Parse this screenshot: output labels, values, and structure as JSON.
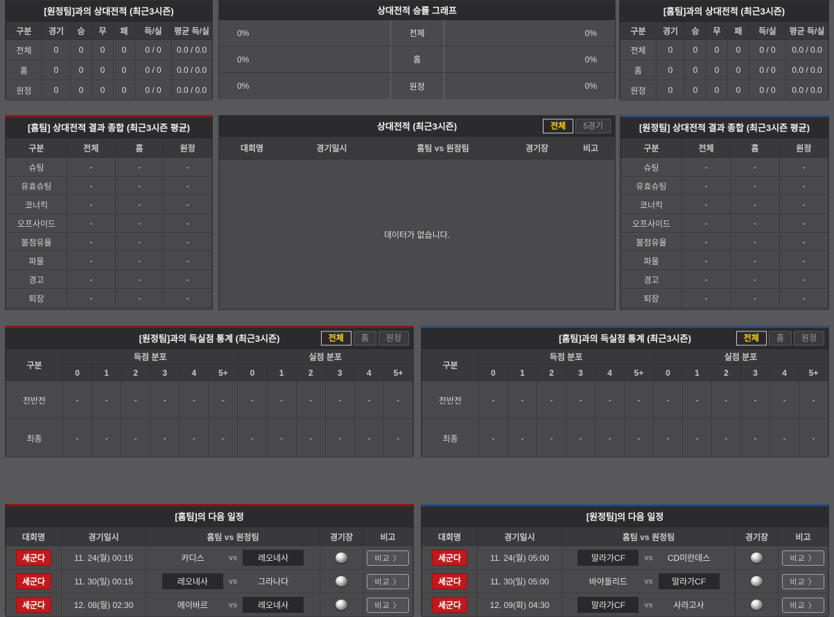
{
  "ui": {
    "vs_label": "vs",
    "compare_button": "비교 〉",
    "empty_dash": "-",
    "empty_message": "데이터가 없습니다."
  },
  "colors": {
    "accent_red": "#8e1418",
    "accent_blue": "#2a4d86",
    "badge_red": "#c2191c",
    "tab_active_text": "#ffd400",
    "page_bg": "#58585a",
    "panel_bg": "#4a4a4c"
  },
  "top_left_record": {
    "title": "[원정팀]과의 상대전적 (최근3시즌)",
    "headers": [
      "구분",
      "경기",
      "승",
      "무",
      "패",
      "득/실",
      "평균 득/실"
    ],
    "rows": [
      {
        "label": "전체",
        "values": [
          "0",
          "0",
          "0",
          "0",
          "0 / 0",
          "0.0 / 0.0"
        ]
      },
      {
        "label": "홈",
        "values": [
          "0",
          "0",
          "0",
          "0",
          "0 / 0",
          "0.0 / 0.0"
        ]
      },
      {
        "label": "원정",
        "values": [
          "0",
          "0",
          "0",
          "0",
          "0 / 0",
          "0.0 / 0.0"
        ]
      }
    ]
  },
  "winrate_graph": {
    "title": "상대전적 승률 그래프",
    "rows": [
      {
        "label": "전체",
        "left_value": "0%",
        "right_value": "0%"
      },
      {
        "label": "홈",
        "left_value": "0%",
        "right_value": "0%"
      },
      {
        "label": "원정",
        "left_value": "0%",
        "right_value": "0%"
      }
    ]
  },
  "top_right_record": {
    "title": "[홈팀]과의 상대전적 (최근3시즌)",
    "headers": [
      "구분",
      "경기",
      "승",
      "무",
      "패",
      "득/실",
      "평균 득/실"
    ],
    "rows": [
      {
        "label": "전체",
        "values": [
          "0",
          "0",
          "0",
          "0",
          "0 / 0",
          "0.0 / 0.0"
        ]
      },
      {
        "label": "홈",
        "values": [
          "0",
          "0",
          "0",
          "0",
          "0 / 0",
          "0.0 / 0.0"
        ]
      },
      {
        "label": "원정",
        "values": [
          "0",
          "0",
          "0",
          "0",
          "0 / 0",
          "0.0 / 0.0"
        ]
      }
    ]
  },
  "home_summary": {
    "title": "[홈팀] 상대전적 결과 종합 (최근3시즌 평균)",
    "headers": [
      "구분",
      "전체",
      "홈",
      "원정"
    ],
    "row_labels": [
      "슈팅",
      "유효슈팅",
      "코너킥",
      "오프사이드",
      "볼점유율",
      "파울",
      "경고",
      "퇴장"
    ]
  },
  "h2h": {
    "title": "상대전적 (최근3시즌)",
    "tabs": [
      {
        "label": "전체",
        "active": true
      },
      {
        "label": "5경기",
        "active": false
      }
    ],
    "headers": [
      "대회명",
      "경기일시",
      "홈팀  vs  원정팀",
      "경기장",
      "비고"
    ]
  },
  "away_summary": {
    "title": "[원정팀] 상대전적 결과 종합 (최근3시즌 평균)",
    "headers": [
      "구분",
      "전체",
      "홈",
      "원정"
    ],
    "row_labels": [
      "슈팅",
      "유효슈팅",
      "코너킥",
      "오프사이드",
      "볼점유율",
      "파울",
      "경고",
      "퇴장"
    ]
  },
  "goals_vs_away": {
    "title": "[원정팀]과의 득실점 통계 (최근3시즌)",
    "tabs": [
      {
        "label": "전체",
        "active": true
      },
      {
        "label": "홈",
        "active": false
      },
      {
        "label": "원정",
        "active": false
      }
    ],
    "corner_header": "구분",
    "group_headers": [
      "득점 분포",
      "실점 분포"
    ],
    "bins": [
      "0",
      "1",
      "2",
      "3",
      "4",
      "5+"
    ],
    "row_labels": [
      "전반전",
      "최종"
    ]
  },
  "goals_vs_home": {
    "title": "[홈팀]과의 득실점 통계 (최근3시즌)",
    "tabs": [
      {
        "label": "전체",
        "active": true
      },
      {
        "label": "홈",
        "active": false
      },
      {
        "label": "원정",
        "active": false
      }
    ],
    "corner_header": "구분",
    "group_headers": [
      "득점 분포",
      "실점 분포"
    ],
    "bins": [
      "0",
      "1",
      "2",
      "3",
      "4",
      "5+"
    ],
    "row_labels": [
      "전반전",
      "최종"
    ]
  },
  "home_schedule": {
    "title": "[홈팀]의 다음 일정",
    "headers": [
      "대회명",
      "경기일시",
      "홈팀  vs  원정팀",
      "경기장",
      "비고"
    ],
    "rows": [
      {
        "league": "세군다",
        "datetime": "11. 24(월) 00:15",
        "home_team": "카디스",
        "away_team": "레오네사",
        "highlighted": "away"
      },
      {
        "league": "세군다",
        "datetime": "11. 30(일) 00:15",
        "home_team": "레오네사",
        "away_team": "그라나다",
        "highlighted": "home"
      },
      {
        "league": "세군다",
        "datetime": "12. 08(월) 02:30",
        "home_team": "에이바르",
        "away_team": "레오네사",
        "highlighted": "away"
      }
    ]
  },
  "away_schedule": {
    "title": "[원정팀]의 다음 일정",
    "headers": [
      "대회명",
      "경기일시",
      "홈팀  vs  원정팀",
      "경기장",
      "비고"
    ],
    "rows": [
      {
        "league": "세군다",
        "datetime": "11. 24(월) 05:00",
        "home_team": "말라가CF",
        "away_team": "CD미란데스",
        "highlighted": "home"
      },
      {
        "league": "세군다",
        "datetime": "11. 30(일) 05:00",
        "home_team": "바야돌리드",
        "away_team": "말라가CF",
        "highlighted": "away"
      },
      {
        "league": "세군다",
        "datetime": "12. 09(화) 04:30",
        "home_team": "말라가CF",
        "away_team": "사라고사",
        "highlighted": "home"
      }
    ]
  }
}
